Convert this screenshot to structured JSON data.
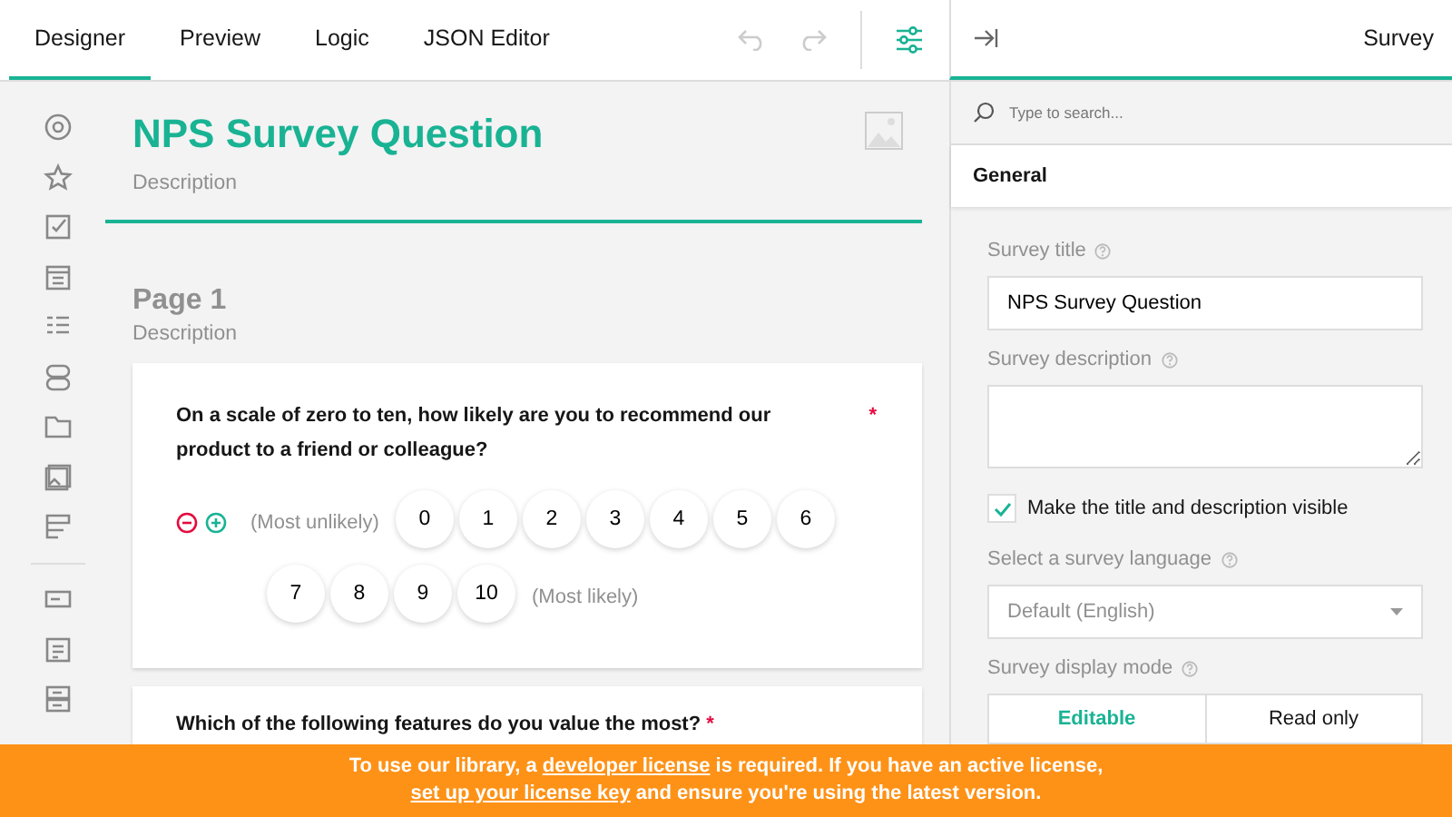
{
  "tabs": [
    {
      "label": "Designer",
      "selected": true
    },
    {
      "label": "Preview",
      "selected": false
    },
    {
      "label": "Logic",
      "selected": false
    },
    {
      "label": "JSON Editor",
      "selected": false
    }
  ],
  "toolbar": {
    "undo_disabled": true,
    "redo_disabled": true
  },
  "survey": {
    "title": "NPS Survey Question",
    "description": "Description"
  },
  "page": {
    "title": "Page 1",
    "description": "Description"
  },
  "questions": [
    {
      "title": "On a scale of zero to ten, how likely are you to recommend our product to a friend or colleague?",
      "required_mark": "*",
      "min_label": "(Most unlikely)",
      "max_label": "(Most likely)",
      "values": [
        "0",
        "1",
        "2",
        "3",
        "4",
        "5",
        "6",
        "7",
        "8",
        "9",
        "10"
      ]
    },
    {
      "title": "Which of the following features do you value the most?",
      "required_mark": "*"
    }
  ],
  "panel": {
    "title": "Survey",
    "search": {
      "placeholder": "Type to search..."
    },
    "section": "General",
    "fields": [
      {
        "kind": "text",
        "label": "Survey title",
        "value": "NPS Survey Question"
      },
      {
        "kind": "textarea",
        "label": "Survey description"
      },
      {
        "kind": "checkbox",
        "label": "Make the title and description visible",
        "checked": true
      },
      {
        "kind": "dropdown",
        "label": "Select a survey language",
        "value": "Default (English)"
      },
      {
        "kind": "segmented",
        "label": "Survey display mode",
        "options": [
          {
            "label": "Editable",
            "selected": true
          },
          {
            "label": "Read only",
            "selected": false
          }
        ]
      }
    ]
  },
  "banner": {
    "parts": [
      {
        "kind": "text",
        "text": "To use our library, a "
      },
      {
        "kind": "link",
        "text": "developer license"
      },
      {
        "kind": "text",
        "text": " is required. If you have an active license, "
      },
      {
        "kind": "link",
        "text": "set up your license key"
      },
      {
        "kind": "text",
        "text": " and ensure you're using the latest version."
      }
    ]
  }
}
